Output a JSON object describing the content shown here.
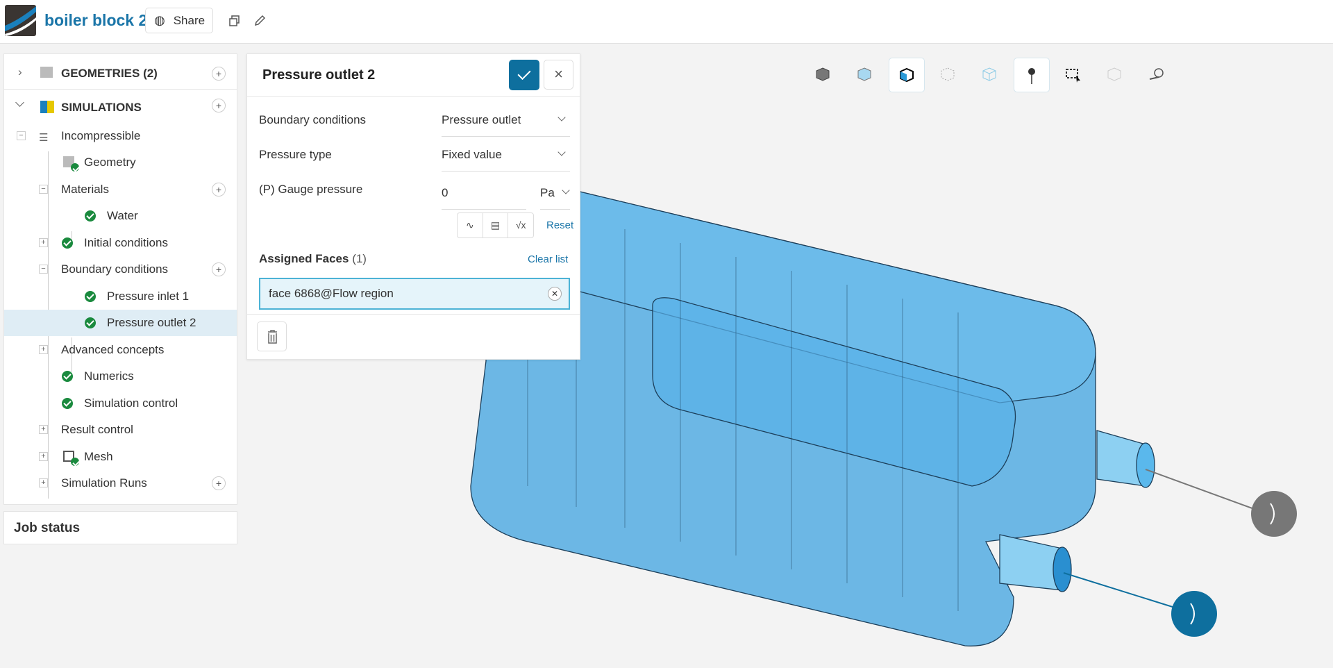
{
  "header": {
    "title": "boiler block 2",
    "share_label": "Share"
  },
  "sidebar": {
    "geometries": "GEOMETRIES (2)",
    "simulations": "SIMULATIONS",
    "items": [
      "Incompressible",
      "Geometry",
      "Materials",
      "Water",
      "Initial conditions",
      "Boundary conditions",
      "Pressure inlet 1",
      "Pressure outlet 2",
      "Advanced concepts",
      "Numerics",
      "Simulation control",
      "Result control",
      "Mesh",
      "Simulation Runs"
    ],
    "job_status": "Job status"
  },
  "panel": {
    "title": "Pressure outlet 2",
    "bc_label": "Boundary conditions",
    "bc_value": "Pressure outlet",
    "ptype_label": "Pressure type",
    "ptype_value": "Fixed value",
    "gauge_label": "(P) Gauge pressure",
    "gauge_value": "0",
    "gauge_unit": "Pa",
    "reset": "Reset",
    "assigned_label": "Assigned Faces",
    "assigned_count": "(1)",
    "clear_list": "Clear list",
    "faces": [
      "face 6868@Flow region"
    ],
    "fn_icons": [
      "∿",
      "▤",
      "√x"
    ]
  },
  "colors": {
    "accent": "#0e6f9e",
    "link": "#1a75a8",
    "model": "#3fa3e0",
    "check": "#1a8a3e"
  }
}
